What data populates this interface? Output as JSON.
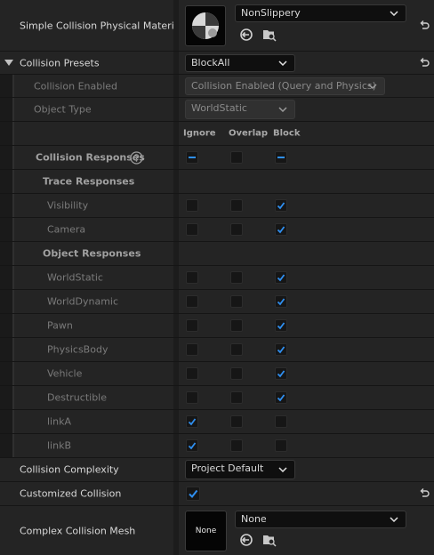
{
  "material": {
    "label": "Simple Collision Physical Material",
    "value": "NonSlippery"
  },
  "presets": {
    "label": "Collision Presets",
    "value": "BlockAll"
  },
  "collision_enabled": {
    "label": "Collision Enabled",
    "value": "Collision Enabled (Query and Physics)"
  },
  "object_type": {
    "label": "Object Type",
    "value": "WorldStatic"
  },
  "columns": {
    "ignore": "Ignore",
    "overlap": "Overlap",
    "block": "Block"
  },
  "responses": {
    "label": "Collision Responses",
    "ignore_state": "mixed",
    "overlap_state": "off",
    "block_state": "mixed"
  },
  "trace": {
    "header": "Trace Responses",
    "items": [
      {
        "label": "Visibility",
        "response": "block"
      },
      {
        "label": "Camera",
        "response": "block"
      }
    ]
  },
  "object": {
    "header": "Object Responses",
    "items": [
      {
        "label": "WorldStatic",
        "response": "block"
      },
      {
        "label": "WorldDynamic",
        "response": "block"
      },
      {
        "label": "Pawn",
        "response": "block"
      },
      {
        "label": "PhysicsBody",
        "response": "block"
      },
      {
        "label": "Vehicle",
        "response": "block"
      },
      {
        "label": "Destructible",
        "response": "block"
      },
      {
        "label": "linkA",
        "response": "ignore"
      },
      {
        "label": "linkB",
        "response": "ignore"
      }
    ]
  },
  "complexity": {
    "label": "Collision Complexity",
    "value": "Project Default"
  },
  "customized": {
    "label": "Customized Collision",
    "checked": true
  },
  "mesh": {
    "label": "Complex Collision Mesh",
    "value": "None",
    "thumb_text": "None"
  },
  "colors": {
    "check": "#2f8ff0",
    "panel": "#242424",
    "input": "#0f0f0f"
  }
}
